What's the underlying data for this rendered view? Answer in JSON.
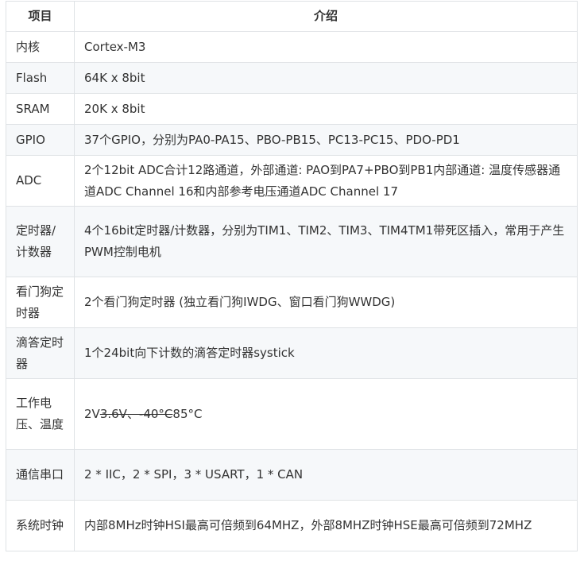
{
  "header": {
    "item": "项目",
    "desc": "介绍"
  },
  "rows": [
    {
      "key": "内核",
      "value": "Cortex-M3"
    },
    {
      "key": "Flash",
      "value": "64K x 8bit"
    },
    {
      "key": "SRAM",
      "value": "20K x 8bit"
    },
    {
      "key": "GPIO",
      "value": "37个GPIO，分别为PA0-PA15、PBO-PB15、PC13-PC15、PDO-PD1"
    },
    {
      "key": "ADC",
      "value": "2个12bit ADC合计12路通道，外部通道: PAO到PA7+PBO到PB1内部通道: 温度传感器通道ADC Channel 16和内部参考电压通道ADC Channel 17"
    },
    {
      "key": "定时器/计数器",
      "value": "4个16bit定时器/计数器，分别为TIM1、TIM2、TIM3、TIM4TM1带死区插入，常用于产生PWM控制电机"
    },
    {
      "key": "看门狗定时器",
      "value": "2个看门狗定时器 (独立看门狗IWDG、窗口看门狗WWDG)"
    },
    {
      "key": "滴答定时器",
      "value": "1个24bit向下计数的滴答定时器systick"
    },
    {
      "key": "工作电压、温度",
      "value_a": "2V",
      "value_strike": "3.6V、-40°C",
      "value_b": "85°C"
    },
    {
      "key": "通信串口",
      "value": "2 * IIC，2 * SPI，3 * USART，1 * CAN"
    },
    {
      "key": "系统时钟",
      "value": "内部8MHz时钟HSI最高可倍频到64MHZ，外部8MHZ时钟HSE最高可倍频到72MHZ"
    }
  ]
}
